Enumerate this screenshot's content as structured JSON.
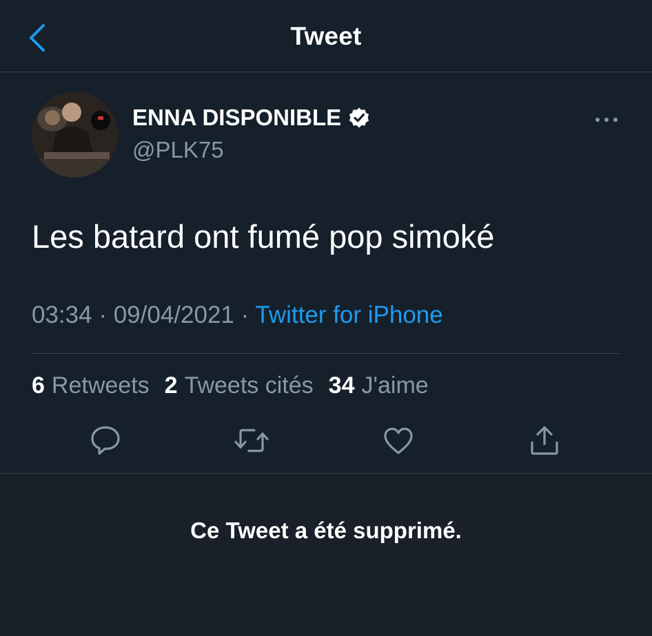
{
  "header": {
    "title": "Tweet",
    "back_icon": "chevron-left-icon"
  },
  "tweet": {
    "author": {
      "name": "ENNA DISPONIBLE",
      "handle": "@PLK75",
      "verified": true
    },
    "text": "Les batard ont fumé pop simoké",
    "time": "03:34",
    "date": "09/04/2021",
    "separator": "·",
    "source": "Twitter for iPhone",
    "stats": {
      "retweets_count": "6",
      "retweets_label": "Retweets",
      "quotes_count": "2",
      "quotes_label": "Tweets cités",
      "likes_count": "34",
      "likes_label": "J'aime"
    }
  },
  "actions": [
    "reply-icon",
    "retweet-icon",
    "like-icon",
    "share-icon"
  ],
  "deleted_notice": "Ce Tweet a été supprimé.",
  "colors": {
    "background": "#15202b",
    "accent": "#1d9bf0",
    "secondary_text": "#8899a6",
    "divider": "#38444d"
  }
}
